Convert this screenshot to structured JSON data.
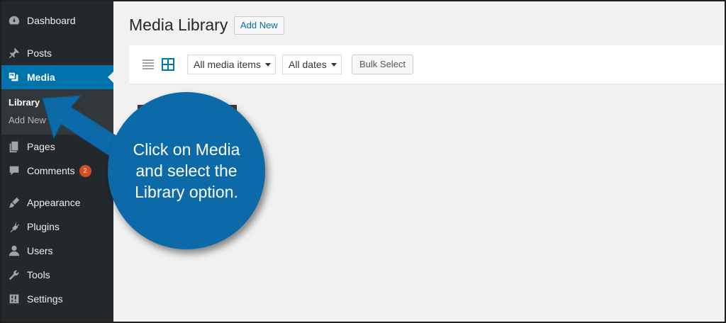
{
  "sidebar": {
    "items": [
      {
        "name": "dashboard",
        "label": "Dashboard",
        "icon": "dashboard-icon"
      },
      {
        "name": "posts",
        "label": "Posts",
        "icon": "pin-icon"
      },
      {
        "name": "media",
        "label": "Media",
        "icon": "media-icon",
        "active": true
      },
      {
        "name": "pages",
        "label": "Pages",
        "icon": "pages-icon"
      },
      {
        "name": "comments",
        "label": "Comments",
        "icon": "comment-icon",
        "badge": "2"
      },
      {
        "name": "appearance",
        "label": "Appearance",
        "icon": "brush-icon"
      },
      {
        "name": "plugins",
        "label": "Plugins",
        "icon": "plug-icon"
      },
      {
        "name": "users",
        "label": "Users",
        "icon": "user-icon"
      },
      {
        "name": "tools",
        "label": "Tools",
        "icon": "wrench-icon"
      },
      {
        "name": "settings",
        "label": "Settings",
        "icon": "sliders-icon"
      }
    ],
    "media_submenu": [
      {
        "label": "Library",
        "current": true
      },
      {
        "label": "Add New"
      }
    ]
  },
  "main": {
    "title": "Media Library",
    "add_new_label": "Add New",
    "toolbar": {
      "media_filter": "All media items",
      "date_filter": "All dates",
      "bulk_select_label": "Bulk Select"
    }
  },
  "callout": {
    "text": "Click on Media and select the Library option."
  },
  "colors": {
    "sidebar_bg": "#23282d",
    "active_bg": "#0073aa",
    "callout_bg": "#0c6aa8",
    "badge_bg": "#d54e21"
  }
}
